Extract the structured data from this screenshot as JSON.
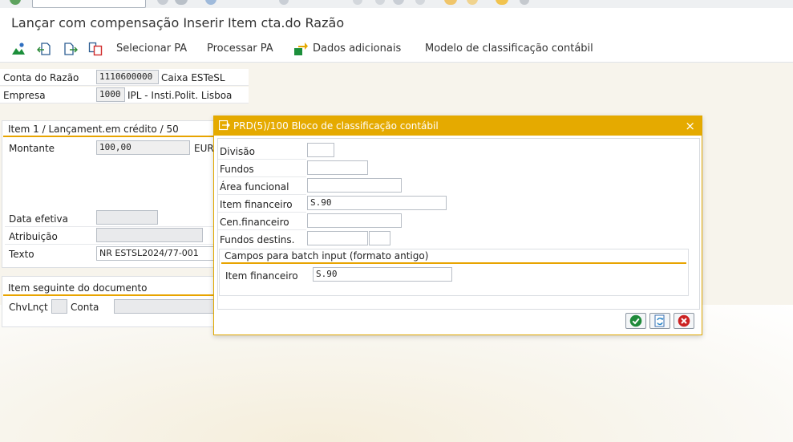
{
  "window": {
    "title": "Lançar com compensação Inserir Item cta.do Razão"
  },
  "toolbar": {
    "selecionar_pa": "Selecionar PA",
    "processar_pa": "Processar PA",
    "dados_adicionais": "Dados adicionais",
    "modelo": "Modelo de classificação contábil"
  },
  "header": {
    "conta_label": "Conta do Razão",
    "conta_value": "1110600000",
    "conta_desc": "Caixa ESTeSL",
    "empresa_label": "Empresa",
    "empresa_value": "1000",
    "empresa_desc": "IPL - Insti.Polit. Lisboa"
  },
  "item": {
    "title": "Item 1 / Lançament.em crédito / 50",
    "montante_label": "Montante",
    "montante_value": "100,00",
    "currency": "EUR",
    "data_label": "Data efetiva",
    "data_value": "",
    "atrib_label": "Atribuição",
    "atrib_value": "",
    "texto_label": "Texto",
    "texto_value": "NR ESTSL2024/77-001"
  },
  "next": {
    "title": "Item seguinte do documento",
    "chv_label": "ChvLnçt",
    "chv_value": "",
    "conta_label": "Conta",
    "conta_value": ""
  },
  "dialog": {
    "title": "PRD(5)/100 Bloco de classificação contábil",
    "divisao_label": "Divisão",
    "divisao_value": "",
    "fundos_label": "Fundos",
    "fundos_value": "",
    "area_label": "Área funcional",
    "area_value": "",
    "itemfin_label": "Item financeiro",
    "itemfin_value": "S.90",
    "cenfin_label": "Cen.financeiro",
    "cenfin_value": "",
    "fundosd_label": "Fundos destins.",
    "fundosd_value1": "",
    "fundosd_value2": "",
    "batch_title": "Campos para batch input (formato antigo)",
    "batch_itemfin_label": "Item financeiro",
    "batch_itemfin_value": "S.90"
  },
  "icons": {
    "close": "×",
    "confirm": "check-icon",
    "refresh": "refresh-icon",
    "cancel": "cancel-icon"
  },
  "colors": {
    "accent": "#e5aa00",
    "confirm": "#1f8a3a",
    "cancel": "#cc2222"
  }
}
